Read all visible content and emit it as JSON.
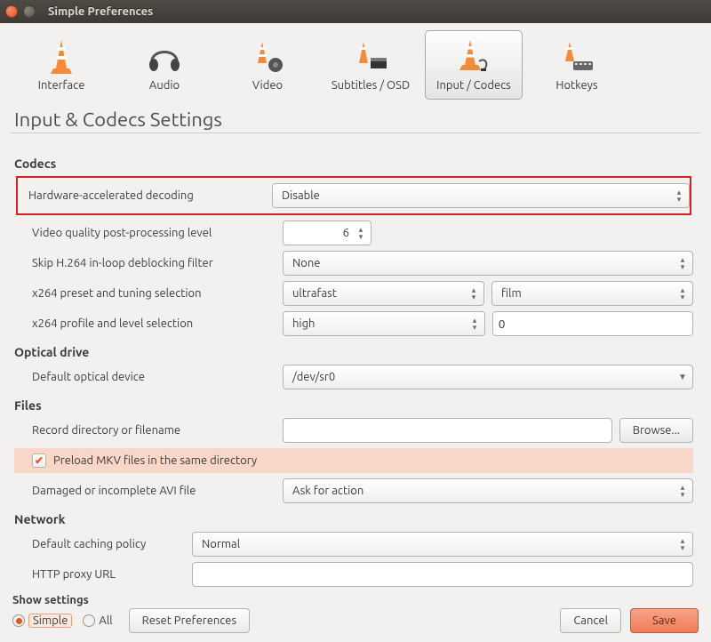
{
  "window": {
    "title": "Simple Preferences"
  },
  "tabs": {
    "interface": "Interface",
    "audio": "Audio",
    "video": "Video",
    "subtitles": "Subtitles / OSD",
    "input_codecs": "Input / Codecs",
    "hotkeys": "Hotkeys"
  },
  "heading": "Input & Codecs Settings",
  "codecs": {
    "header": "Codecs",
    "hw_decoding_label": "Hardware-accelerated decoding",
    "hw_decoding_value": "Disable",
    "postproc_label": "Video quality post-processing level",
    "postproc_value": "6",
    "skip_loop_label": "Skip H.264 in-loop deblocking filter",
    "skip_loop_value": "None",
    "x264_preset_label": "x264 preset and tuning selection",
    "x264_preset_value": "ultrafast",
    "x264_tune_value": "film",
    "x264_profile_label": "x264 profile and level selection",
    "x264_profile_value": "high",
    "x264_level_value": "0"
  },
  "optical": {
    "header": "Optical drive",
    "device_label": "Default optical device",
    "device_value": "/dev/sr0"
  },
  "files": {
    "header": "Files",
    "record_label": "Record directory or filename",
    "record_value": "",
    "browse_label": "Browse...",
    "preload_label": "Preload MKV files in the same directory",
    "preload_checked": true,
    "avi_label": "Damaged or incomplete AVI file",
    "avi_value": "Ask for action"
  },
  "network": {
    "header": "Network",
    "caching_label": "Default caching policy",
    "caching_value": "Normal",
    "proxy_label": "HTTP proxy URL",
    "proxy_value": ""
  },
  "footer": {
    "show_header": "Show settings",
    "simple_label": "Simple",
    "all_label": "All",
    "reset_label": "Reset Preferences",
    "cancel_label": "Cancel",
    "save_label": "Save"
  }
}
